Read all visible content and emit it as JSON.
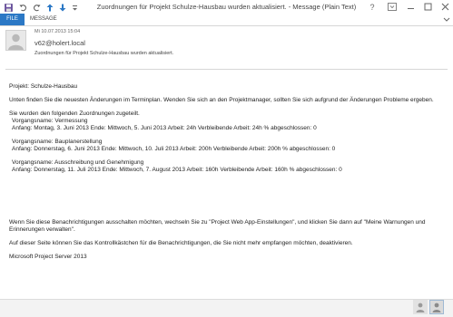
{
  "window": {
    "title": "Zuordnungen für Projekt Schulze-Hausbau wurden aktualisiert. - Message (Plain Text)"
  },
  "ribbon": {
    "tabs": [
      {
        "label": "FILE"
      },
      {
        "label": "MESSAGE"
      }
    ]
  },
  "message": {
    "timestamp": "Mi 10.07.2013 15:04",
    "sender": "v62@holert.local",
    "subject": "Zuordnungen für Projekt Schulze-Hausbau wurden aktualisiert.",
    "body": {
      "project_line": "Projekt: Schulze-Hausbau",
      "intro": "Unten finden Sie die neuesten Änderungen im Terminplan. Wenden Sie sich an den Projektmanager, sollten Sie sich aufgrund der Änderungen Probleme ergeben.",
      "assigned_intro": "Sie wurden den folgenden Zuordnungen zugeteilt.",
      "tasks": [
        {
          "name_line": " Vorgangsname: Vermessung",
          "detail_line": " Anfang: Montag, 3. Juni 2013  Ende: Mittwoch, 5. Juni 2013  Arbeit: 24h  Verbleibende Arbeit: 24h  % abgeschlossen: 0"
        },
        {
          "name_line": " Vorgangsname: Bauplanerstellung",
          "detail_line": " Anfang: Donnerstag, 6. Juni 2013  Ende: Mittwoch, 10. Juli 2013  Arbeit: 200h  Verbleibende Arbeit: 200h  % abgeschlossen: 0"
        },
        {
          "name_line": " Vorgangsname: Ausschreibung und Genehmigung",
          "detail_line": " Anfang: Donnerstag, 11. Juli 2013  Ende: Mittwoch, 7. August 2013  Arbeit: 160h  Verbleibende Arbeit: 160h  % abgeschlossen: 0"
        }
      ],
      "notification_off": "Wenn Sie diese Benachrichtigungen ausschalten möchten, wechseln Sie zu \"Project Web App-Einstellungen\", und klicken Sie dann auf \"Meine Warnungen und Erinnerungen verwalten\".",
      "checkbox_note": "Auf dieser Seite können Sie das Kontrollkästchen für die Benachrichtigungen, die Sie nicht mehr empfangen möchten, deaktivieren.",
      "signature": "Microsoft Project Server 2013"
    }
  },
  "icons": {
    "quick_access": [
      "save-icon",
      "undo-icon",
      "redo-icon",
      "up-arrow-icon",
      "down-arrow-icon",
      "more-icon"
    ],
    "window_controls": [
      "help-icon",
      "ribbon-display-icon",
      "minimize-icon",
      "maximize-icon",
      "close-icon"
    ],
    "bottom": [
      "person-icon",
      "people-pane-icon"
    ]
  },
  "colors": {
    "file_tab": "#2b78c5",
    "accent": "#2b78c5"
  }
}
